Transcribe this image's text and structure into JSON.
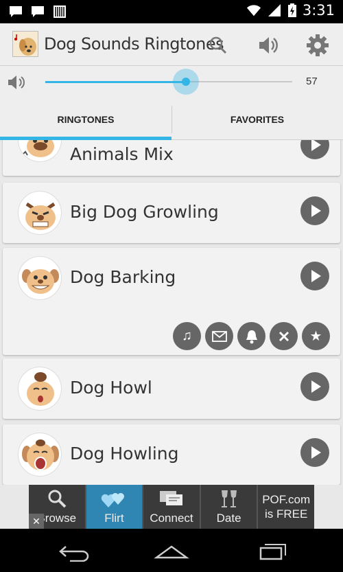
{
  "status_bar": {
    "time": "3:31"
  },
  "action_bar": {
    "title": "Dog Sounds Ringtones"
  },
  "volume": {
    "value": "57",
    "level": 0.57
  },
  "tabs": [
    {
      "label": "RINGTONES",
      "active": true
    },
    {
      "label": "FAVORITES",
      "active": false
    }
  ],
  "ringtones": [
    {
      "name": "Animals Mix"
    },
    {
      "name": "Big Dog Growling"
    },
    {
      "name": "Dog Barking"
    },
    {
      "name": "Dog Howl"
    },
    {
      "name": "Dog Howling"
    }
  ],
  "expanded_actions": [
    "music-note-icon",
    "envelope-icon",
    "bell-icon",
    "close-icon",
    "star-icon"
  ],
  "ad": {
    "items": [
      {
        "label": "Browse",
        "icon": "magnifier-icon"
      },
      {
        "label": "Flirt",
        "icon": "hearts-icon"
      },
      {
        "label": "Connect",
        "icon": "chat-icon"
      },
      {
        "label": "Date",
        "icon": "wine-glasses-icon"
      }
    ],
    "pof_line1": "POF.com",
    "pof_line2": "is FREE",
    "close_label": "✕"
  },
  "colors": {
    "accent": "#33b5e5",
    "card": "#f2f2f2",
    "button": "#666666"
  }
}
